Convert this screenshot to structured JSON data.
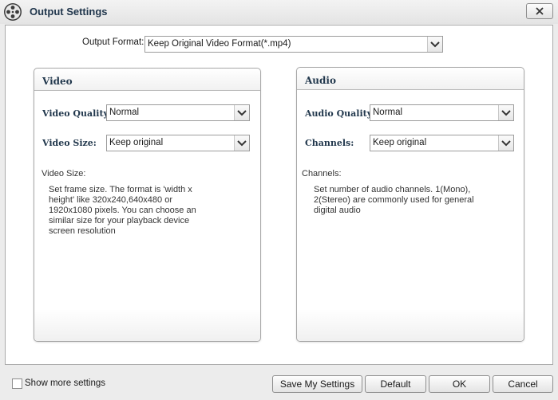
{
  "window": {
    "title": "Output Settings",
    "app_icon": "film-reel-icon",
    "close_icon": "close-icon"
  },
  "output_format": {
    "label": "Output Format:",
    "value": "Keep Original Video Format(*.mp4)"
  },
  "video": {
    "title": "Video",
    "quality_label": "Video Quality:",
    "quality_value": "Normal",
    "size_label": "Video Size:",
    "size_value": "Keep original",
    "help_label": "Video Size:",
    "help_text": "Set frame size. The format is 'width x height' like 320x240,640x480 or 1920x1080 pixels. You can choose an similar size for your playback device screen resolution"
  },
  "audio": {
    "title": "Audio",
    "quality_label": "Audio Quality:",
    "quality_value": "Normal",
    "channels_label": "Channels:",
    "channels_value": "Keep original",
    "help_label": "Channels:",
    "help_text": "Set number of audio channels. 1(Mono), 2(Stereo) are commonly used for general digital audio"
  },
  "footer": {
    "show_more_label": "Show more settings",
    "show_more_checked": false,
    "save_label": "Save My Settings",
    "default_label": "Default",
    "ok_label": "OK",
    "cancel_label": "Cancel"
  },
  "colors": {
    "title_text": "#20364c",
    "border": "#a8a8a8"
  }
}
